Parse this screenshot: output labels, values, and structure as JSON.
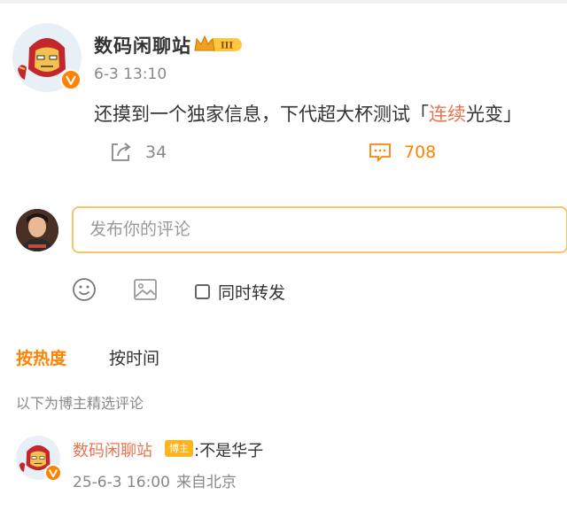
{
  "post": {
    "author": "数码闲聊站",
    "member_level": "III",
    "time": "6-3 13:10",
    "text_before": "还摸到一个独家信息，下代超大杯测试「",
    "text_highlight": "连续",
    "text_after": "光变」",
    "repost_count": "34",
    "comment_count": "708"
  },
  "composer": {
    "placeholder": "发布你的评论",
    "forward_label": "同时转发"
  },
  "sort_tabs": {
    "hot": "按热度",
    "time": "按时间"
  },
  "section_note": "以下为博主精选评论",
  "comments": [
    {
      "author": "数码闲聊站",
      "badge": "博主",
      "text": ":不是华子",
      "date": "25-6-3 16:00",
      "location": "来自北京"
    }
  ],
  "colors": {
    "accent_orange": "#ff8200",
    "link": "#eb7350",
    "composer_border": "#f7c36b"
  },
  "icons": [
    "ironman-avatar",
    "verified-badge-icon",
    "crown-level-icon",
    "repost-icon",
    "comment-icon",
    "emoji-icon",
    "image-icon"
  ]
}
